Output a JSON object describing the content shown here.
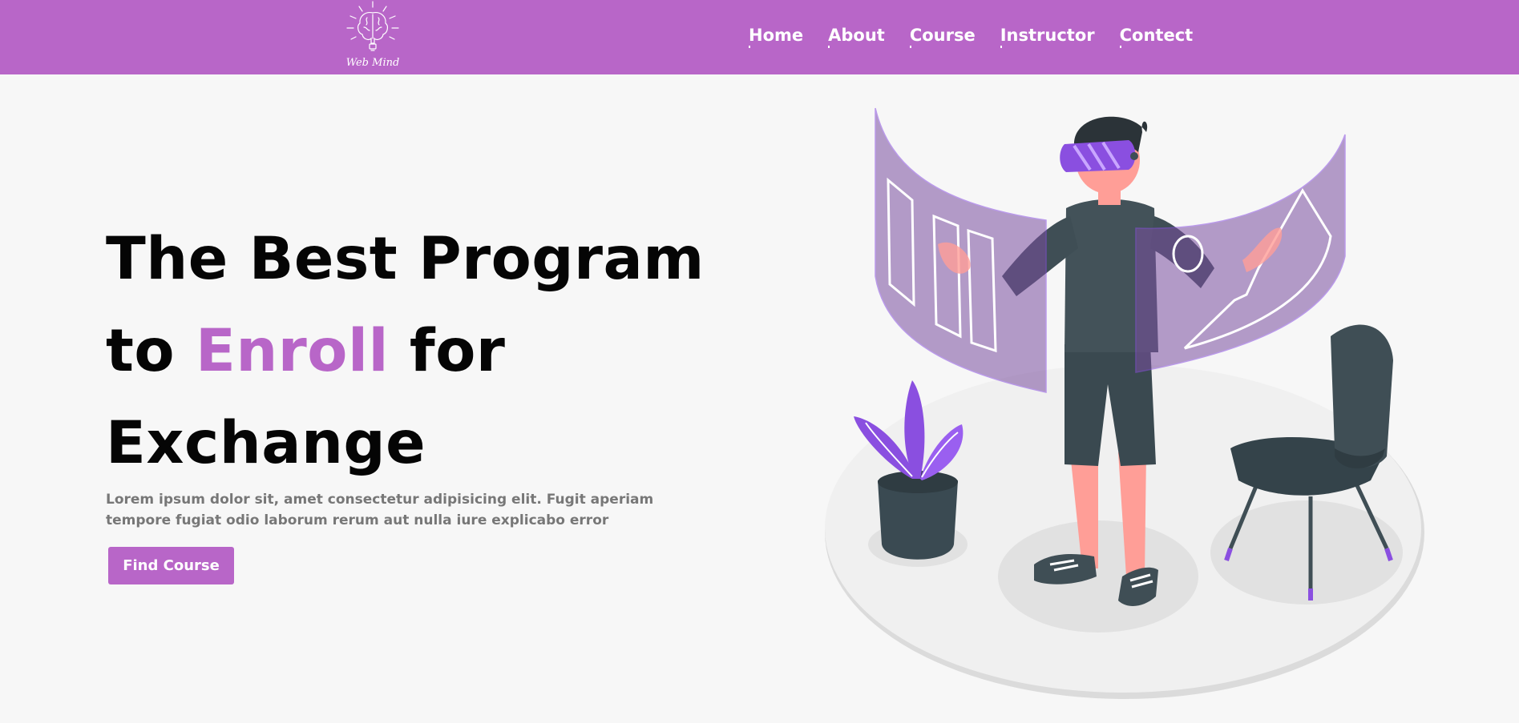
{
  "brand": {
    "logo_text": "Web Mind",
    "logo_icon": "brain-lightbulb-icon"
  },
  "nav": {
    "items": [
      {
        "label": "Home"
      },
      {
        "label": "About"
      },
      {
        "label": "Course"
      },
      {
        "label": "Instructor"
      },
      {
        "label": "Contect"
      }
    ]
  },
  "hero": {
    "title_part1": "The Best Program",
    "title_part2_pre": "to ",
    "title_accent": "Enroll",
    "title_part2_post": " for",
    "title_part3": "Exchange",
    "description": "Lorem ipsum dolor sit, amet consectetur adipisicing elit. Fugit aperiam tempore fugiat odio laborum rerum aut nulla iure explicabo error",
    "cta_label": "Find Course"
  },
  "colors": {
    "brand": "#b866c8",
    "background": "#f7f7f7",
    "heading": "#050505",
    "body_text": "#777777",
    "illustration_accent": "#8a4fe0",
    "illustration_dark": "#3f4e55",
    "skin": "#ff9e97"
  }
}
